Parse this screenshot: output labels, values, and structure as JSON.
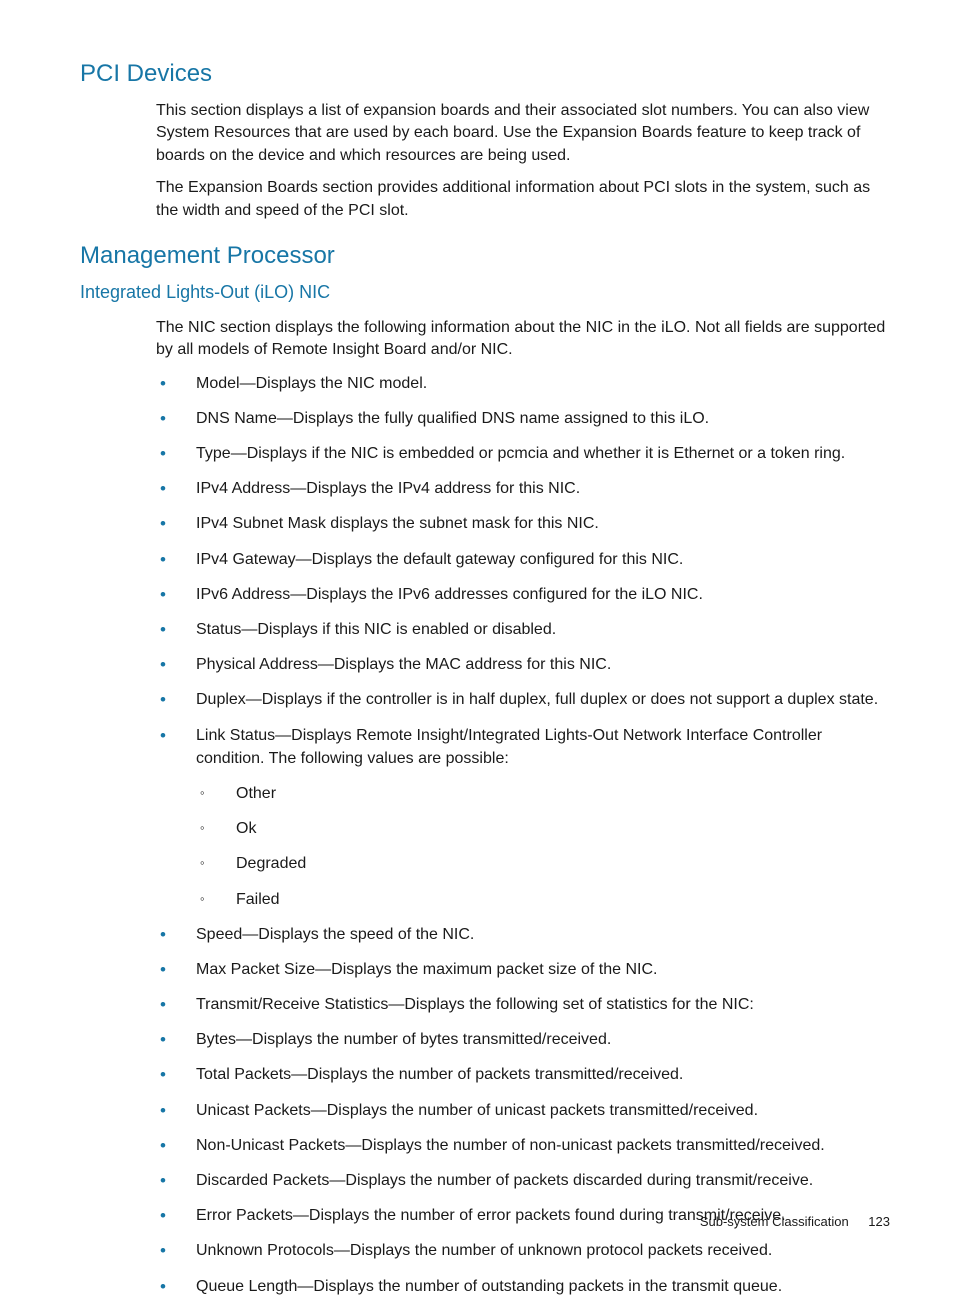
{
  "sections": {
    "pci": {
      "title": "PCI Devices",
      "p1": "This section displays a list of expansion boards and their associated slot numbers. You can also view System Resources that are used by each board. Use the Expansion Boards feature to keep track of boards on the device and which resources are being used.",
      "p2": "The Expansion Boards section provides additional information about PCI slots in the system, such as the width and speed of the PCI slot."
    },
    "mp": {
      "title": "Management Processor",
      "sub": {
        "title": "Integrated Lights-Out (iLO) NIC",
        "intro": "The NIC section displays the following information about the NIC in the iLO. Not all fields are supported by all models of Remote Insight Board and/or NIC.",
        "items": [
          "Model—Displays the NIC model.",
          "DNS Name—Displays the fully qualified DNS name assigned to this iLO.",
          "Type—Displays if the NIC is embedded or pcmcia and whether it is Ethernet or a token ring.",
          "IPv4 Address—Displays the IPv4 address for this NIC.",
          "IPv4 Subnet Mask displays the subnet mask for this NIC.",
          "IPv4 Gateway—Displays the default gateway configured for this NIC.",
          "IPv6 Address—Displays the IPv6 addresses configured for the iLO NIC.",
          "Status—Displays if this NIC is enabled or disabled.",
          "Physical Address—Displays the MAC address for this NIC.",
          "Duplex—Displays if the controller is in half duplex, full duplex or does not support a duplex state.",
          "Link Status—Displays Remote Insight/Integrated Lights-Out Network Interface Controller condition. The following values are possible:",
          "Speed—Displays the speed of the NIC.",
          "Max Packet Size—Displays the maximum packet size of the NIC.",
          "Transmit/Receive Statistics—Displays the following set of statistics for the NIC:",
          "Bytes—Displays the number of bytes transmitted/received.",
          "Total Packets—Displays the number of packets transmitted/received.",
          "Unicast Packets—Displays the number of unicast packets transmitted/received.",
          "Non-Unicast Packets—Displays the number of non-unicast packets transmitted/received.",
          "Discarded Packets—Displays the number of packets discarded during transmit/receive.",
          "Error Packets—Displays the number of error packets found during transmit/receive.",
          "Unknown Protocols—Displays the number of unknown protocol packets received.",
          "Queue Length—Displays the number of outstanding packets in the transmit queue."
        ],
        "linkStatusValues": [
          "Other",
          "Ok",
          "Degraded",
          "Failed"
        ]
      }
    }
  },
  "footer": {
    "label": "Sub-system Classification",
    "page": "123"
  }
}
